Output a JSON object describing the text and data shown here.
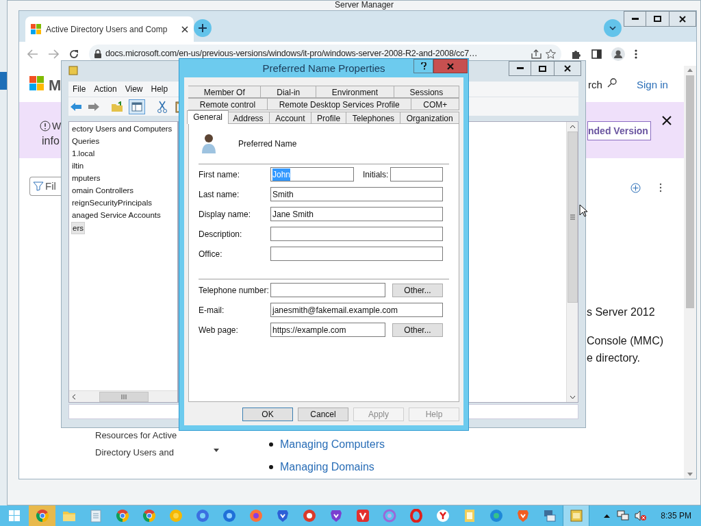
{
  "background_window": {
    "title": "Server Manager"
  },
  "browser": {
    "tab": {
      "title": "Active Directory Users and Comp",
      "selected": true
    },
    "address": "docs.microsoft.com/en-us/previous-versions/windows/it-pro/windows-server-2008-R2-and-2008/cc7…",
    "page": {
      "logo_text": "M",
      "search_label": "rch",
      "sign_in": "Sign in",
      "banner": {
        "line_1": "W",
        "line_2": "info",
        "button": "nded Version"
      },
      "filter": {
        "placeholder": "Fil"
      },
      "nav_items": [
        "Resources for Active",
        "Directory Users and"
      ],
      "body_lines": [
        "s Server 2012",
        "Console (MMC)",
        "e directory."
      ],
      "links": [
        "Managing Computers",
        "Managing Domains"
      ]
    }
  },
  "mmc": {
    "menu": [
      "File",
      "Action",
      "View",
      "Help"
    ],
    "tree": [
      {
        "label": "ectory Users and Computers",
        "selected": false
      },
      {
        "label": "Queries",
        "selected": false
      },
      {
        "label": "1.local",
        "selected": false
      },
      {
        "label": "iltin",
        "selected": false
      },
      {
        "label": "mputers",
        "selected": false
      },
      {
        "label": "omain Controllers",
        "selected": false
      },
      {
        "label": "reignSecurityPrincipals",
        "selected": false
      },
      {
        "label": "anaged Service Accounts",
        "selected": false
      },
      {
        "label": "ers",
        "selected": true
      }
    ]
  },
  "dialog": {
    "title": "Preferred Name Properties",
    "tab_rows": [
      [
        {
          "label": "Member Of",
          "selected": false
        },
        {
          "label": "Dial-in",
          "selected": false
        },
        {
          "label": "Environment",
          "selected": false
        },
        {
          "label": "Sessions",
          "selected": false
        }
      ],
      [
        {
          "label": "Remote control",
          "selected": false
        },
        {
          "label": "Remote Desktop Services Profile",
          "selected": false
        },
        {
          "label": "COM+",
          "selected": false
        }
      ],
      [
        {
          "label": "General",
          "selected": true
        },
        {
          "label": "Address",
          "selected": false
        },
        {
          "label": "Account",
          "selected": false
        },
        {
          "label": "Profile",
          "selected": false
        },
        {
          "label": "Telephones",
          "selected": false
        },
        {
          "label": "Organization",
          "selected": false
        }
      ]
    ],
    "header_name": "Preferred Name",
    "field_groups": [
      [
        {
          "kind": "name_initials",
          "label": "First name:",
          "value": "John",
          "highlighted": true,
          "second_label": "Initials:"
        },
        {
          "kind": "text",
          "label": "Last name:",
          "value": "Smith",
          "highlighted": false
        },
        {
          "kind": "text",
          "label": "Display name:",
          "value": "Jane Smith",
          "highlighted": false
        },
        {
          "kind": "text",
          "label": "Description:"
        },
        {
          "kind": "text",
          "label": "Office:"
        }
      ],
      [
        {
          "kind": "text_other",
          "label": "Telephone number:",
          "button": "Other..."
        },
        {
          "kind": "text",
          "label": "E-mail:",
          "value": "janesmith@fakemail.example.com",
          "highlighted": false
        },
        {
          "kind": "text_other",
          "label": "Web page:",
          "value": "https://example.com",
          "button": "Other...",
          "highlighted": false
        }
      ]
    ],
    "buttons": [
      {
        "label": "OK",
        "default": true,
        "disabled": false
      },
      {
        "label": "Cancel",
        "default": false,
        "disabled": false
      },
      {
        "label": "Apply",
        "default": false,
        "disabled": true
      },
      {
        "label": "Help",
        "default": false,
        "disabled": true
      }
    ]
  },
  "taskbar": {
    "apps": [
      {
        "kind": "tricolor",
        "selected": true
      },
      {
        "kind": "folder",
        "selected": false
      },
      {
        "kind": "notepad",
        "selected": false
      },
      {
        "kind": "tricolor",
        "selected": false
      },
      {
        "kind": "tricolor",
        "selected": false
      },
      {
        "kind": "amber",
        "selected": false
      },
      {
        "kind": "swirl",
        "selected": false
      },
      {
        "kind": "bluefox",
        "selected": false
      },
      {
        "kind": "orangefox",
        "selected": false
      },
      {
        "kind": "blueshield",
        "selected": false
      },
      {
        "kind": "redbrowser",
        "selected": false
      },
      {
        "kind": "purpleshield",
        "selected": false
      },
      {
        "kind": "redsquare",
        "selected": false
      },
      {
        "kind": "purplering",
        "selected": false
      },
      {
        "kind": "redring",
        "selected": false
      },
      {
        "kind": "whitecircle",
        "selected": false
      },
      {
        "kind": "files",
        "selected": false
      },
      {
        "kind": "tealswirl",
        "selected": false
      },
      {
        "kind": "orangeshield",
        "selected": false
      },
      {
        "kind": "server",
        "selected": false
      },
      {
        "kind": "console",
        "selected": true
      }
    ],
    "time": "8:35 PM"
  }
}
